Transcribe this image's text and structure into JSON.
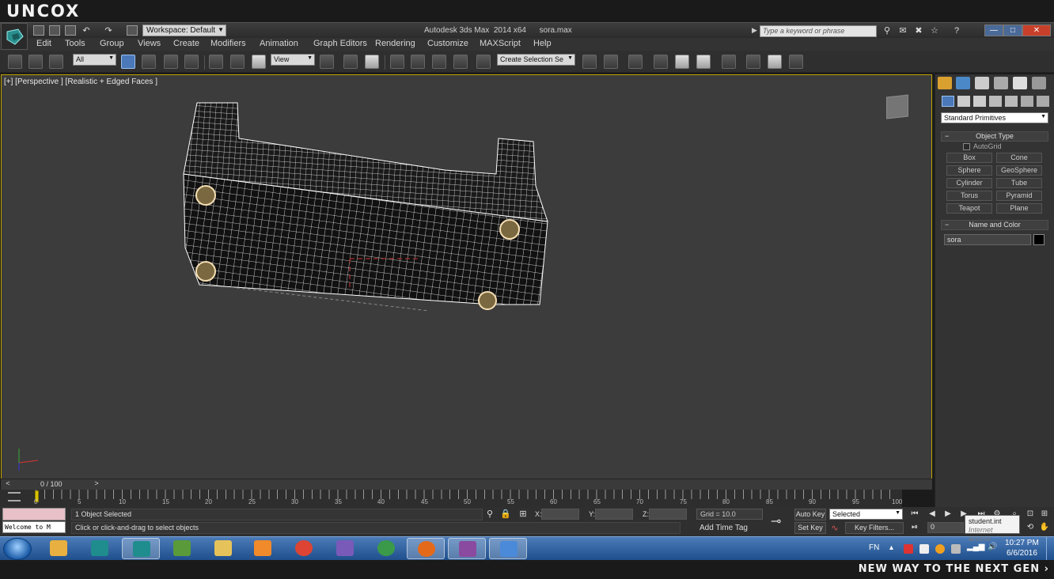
{
  "brand": {
    "logo": "UNCOX",
    "tagline": "NEW WAY TO THE NEXT GEN ›"
  },
  "titlebar": {
    "workspace": "Workspace: Default",
    "title": "Autodesk 3ds Max  2014 x64      sora.max",
    "search_placeholder": "Type a keyword or phrase",
    "window_buttons": [
      "—",
      "□",
      "✕"
    ]
  },
  "menu": [
    "Edit",
    "Tools",
    "Group",
    "Views",
    "Create",
    "Modifiers",
    "Animation",
    "Graph Editors",
    "Rendering",
    "Customize",
    "MAXScript",
    "Help"
  ],
  "toolbar": {
    "selection_filter": "All",
    "reference_coord": "View",
    "named_selection": "Create Selection Se"
  },
  "viewport": {
    "label": "[+] [Perspective ] [Realistic + Edged Faces ]"
  },
  "timeline": {
    "frame_readout": "0 / 100",
    "prev": "<",
    "next": ">",
    "ticks": [
      "0",
      "5",
      "10",
      "15",
      "20",
      "25",
      "30",
      "35",
      "40",
      "45",
      "50",
      "55",
      "60",
      "65",
      "70",
      "75",
      "80",
      "85",
      "90",
      "95",
      "100"
    ]
  },
  "status": {
    "listener": "Welcome to M",
    "selected": "1 Object Selected",
    "prompt": "Click or click-and-drag to select objects",
    "x_label": "X:",
    "y_label": "Y:",
    "z_label": "Z:",
    "grid": "Grid = 10.0",
    "add_time_tag": "Add Time Tag",
    "auto_key": "Auto Key",
    "set_key": "Set Key",
    "key_filters": "Key Filters...",
    "selected_dd": "Selected",
    "frame_value": "0"
  },
  "tooltip": {
    "line1": "student.int",
    "line2": "Internet access"
  },
  "command_panel": {
    "category": "Standard Primitives",
    "object_type_title": "Object Type",
    "autogrid": "AutoGrid",
    "primitives": [
      "Box",
      "Cone",
      "Sphere",
      "GeoSphere",
      "Cylinder",
      "Tube",
      "Torus",
      "Pyramid",
      "Teapot",
      "Plane"
    ],
    "name_color_title": "Name and Color",
    "object_name": "sora",
    "object_color": "#000000"
  },
  "taskbar": {
    "lang": "FN",
    "time": "10:27 PM",
    "date": "6/6/2016",
    "apps": [
      {
        "name": "explorer-libraries-icon",
        "color": "#e8b040"
      },
      {
        "name": "3dsmax-icon",
        "color": "#1f8d8d"
      },
      {
        "name": "evernote-icon",
        "color": "#5a9a3a"
      },
      {
        "name": "folder-icon",
        "color": "#e6c35a"
      },
      {
        "name": "media-player-icon",
        "color": "#f08a2a"
      },
      {
        "name": "chrome-icon",
        "color": "#dd4433"
      },
      {
        "name": "visual-studio-icon",
        "color": "#7a5ab8"
      },
      {
        "name": "globe-icon",
        "color": "#3a9a4a"
      },
      {
        "name": "firefox-icon",
        "color": "#e46a1a"
      },
      {
        "name": "winrar-icon",
        "color": "#8a4aa0"
      },
      {
        "name": "paint-icon",
        "color": "#4a8ad8"
      }
    ]
  },
  "colors": {
    "viewport_border": "#bfa400",
    "viewport_bg": "#3c3c3c",
    "active_tool": "#4a78b8"
  }
}
